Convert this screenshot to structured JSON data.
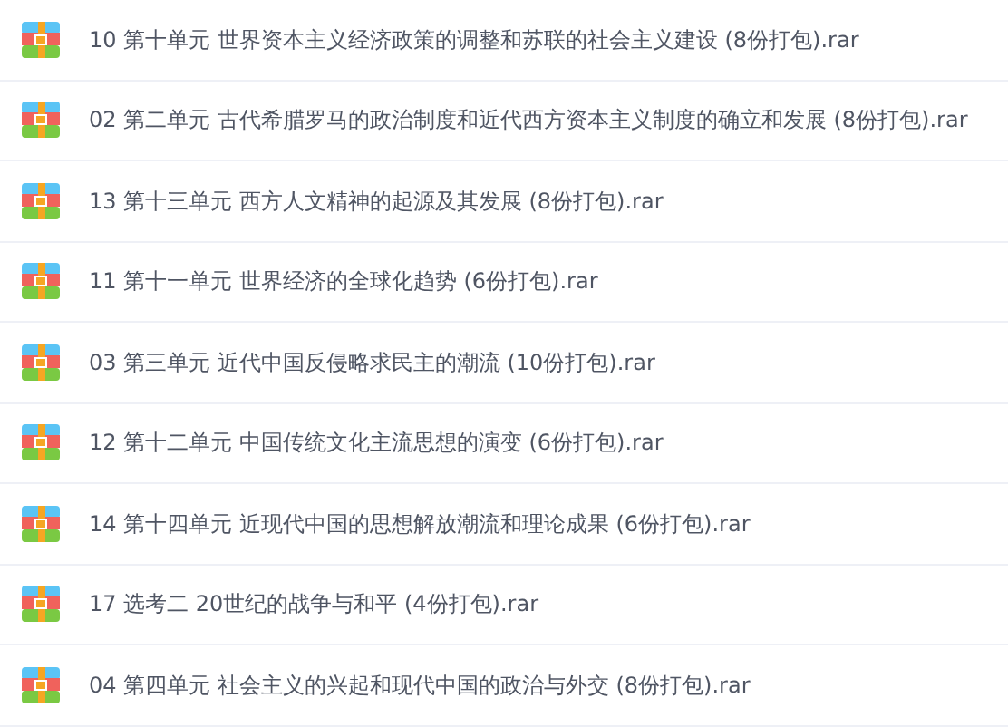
{
  "files": [
    {
      "name": "10 第十单元 世界资本主义经济政策的调整和苏联的社会主义建设 (8份打包).rar"
    },
    {
      "name": "02 第二单元 古代希腊罗马的政治制度和近代西方资本主义制度的确立和发展 (8份打包).rar"
    },
    {
      "name": "13 第十三单元 西方人文精神的起源及其发展 (8份打包).rar"
    },
    {
      "name": "11 第十一单元 世界经济的全球化趋势 (6份打包).rar"
    },
    {
      "name": "03 第三单元 近代中国反侵略求民主的潮流 (10份打包).rar"
    },
    {
      "name": "12 第十二单元 中国传统文化主流思想的演变 (6份打包).rar"
    },
    {
      "name": "14 第十四单元 近现代中国的思想解放潮流和理论成果 (6份打包).rar"
    },
    {
      "name": "17 选考二 20世纪的战争与和平 (4份打包).rar"
    },
    {
      "name": "04 第四单元 社会主义的兴起和现代中国的政治与外交 (8份打包).rar"
    }
  ]
}
